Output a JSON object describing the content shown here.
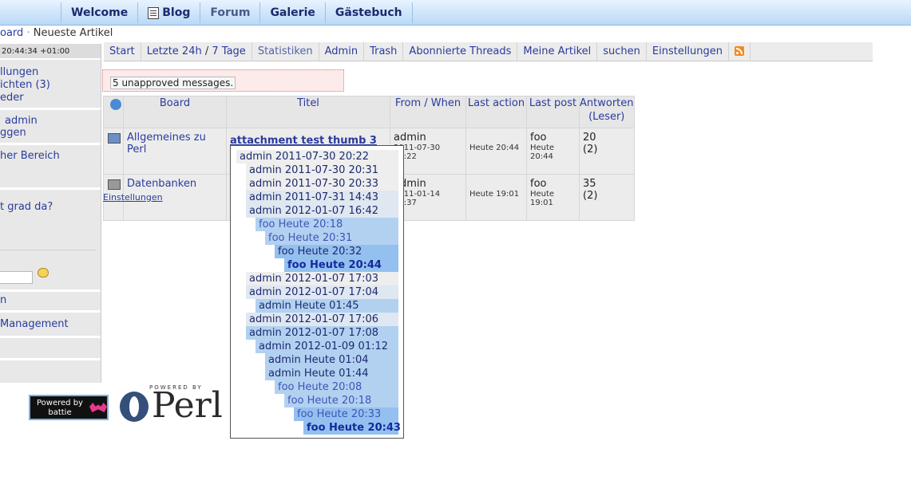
{
  "topnav": [
    {
      "label": "Welcome",
      "icon": ""
    },
    {
      "label": "Blog",
      "icon": "document-icon"
    },
    {
      "label": "Forum",
      "icon": ""
    },
    {
      "label": "Galerie",
      "icon": ""
    },
    {
      "label": "Gästebuch",
      "icon": ""
    }
  ],
  "breadcrumb": {
    "board": "oard",
    "sep": "·",
    "current": "Neueste Artikel"
  },
  "sidebar": {
    "clock": "20:44:34 +01:00",
    "links": [
      "llungen",
      "ichten (3)",
      "eder",
      "admin",
      "ggen",
      "her Bereich",
      "t grad da?",
      "n",
      "Management"
    ]
  },
  "tabs": {
    "start": "Start",
    "last24": "Letzte 24h",
    "slash": "/",
    "days7": "7 Tage",
    "stats": "Statistiken",
    "admin": "Admin",
    "trash": "Trash",
    "subscribed": "Abonnierte Threads",
    "my_articles": "Meine Artikel",
    "search": "suchen",
    "settings": "Einstellungen",
    "rss_icon": "rss-icon"
  },
  "unapproved": "5 unapproved messages.",
  "table": {
    "headers": {
      "board": "Board",
      "title": "Titel",
      "from": "From / When",
      "last_action": "Last action",
      "last_post": "Last post",
      "answers": "Antworten\n(Leser)"
    },
    "rows": [
      {
        "board": "Allgemeines zu Perl",
        "title": "attachment test thumb 3",
        "from": "admin",
        "from_date": "2011-07-30 20:22",
        "last_action": "Heute 20:44",
        "last_post_user": "foo",
        "last_post_time": "Heute 20:44",
        "answers": "20",
        "readers": "(2)"
      },
      {
        "board": "Datenbanken",
        "title": "",
        "from": "admin",
        "from_date": "2011-01-14 18:37",
        "last_action": "Heute 19:01",
        "last_post_user": "foo",
        "last_post_time": "Heute 19:01",
        "answers": "35",
        "readers": "(2)"
      }
    ],
    "settings_link": "Einstellungen"
  },
  "tree": [
    {
      "text": "admin 2011-07-30 20:22"
    },
    {
      "text": "admin 2011-07-30 20:31"
    },
    {
      "text": "admin 2011-07-30 20:33"
    },
    {
      "text": "admin 2011-07-31 14:43"
    },
    {
      "text": "admin 2012-01-07 16:42"
    },
    {
      "text": "foo Heute 20:18"
    },
    {
      "text": "foo Heute 20:31"
    },
    {
      "text": "foo Heute 20:32"
    },
    {
      "text": "foo Heute 20:44"
    },
    {
      "text": "admin 2012-01-07 17:03"
    },
    {
      "text": "admin 2012-01-07 17:04"
    },
    {
      "text": "admin Heute 01:45"
    },
    {
      "text": "admin 2012-01-07 17:06"
    },
    {
      "text": "admin 2012-01-07 17:08"
    },
    {
      "text": "admin 2012-01-09 01:12"
    },
    {
      "text": "admin Heute 01:04"
    },
    {
      "text": "admin Heute 01:44"
    },
    {
      "text": "foo Heute 20:08"
    },
    {
      "text": "foo Heute 20:18"
    },
    {
      "text": "foo Heute 20:33"
    },
    {
      "text": "foo Heute 20:43"
    }
  ],
  "badges": {
    "battie_line1": "Powered by",
    "battie_line2": "battie",
    "perl_powered": "POWERED BY",
    "perl_word": "Perl"
  }
}
